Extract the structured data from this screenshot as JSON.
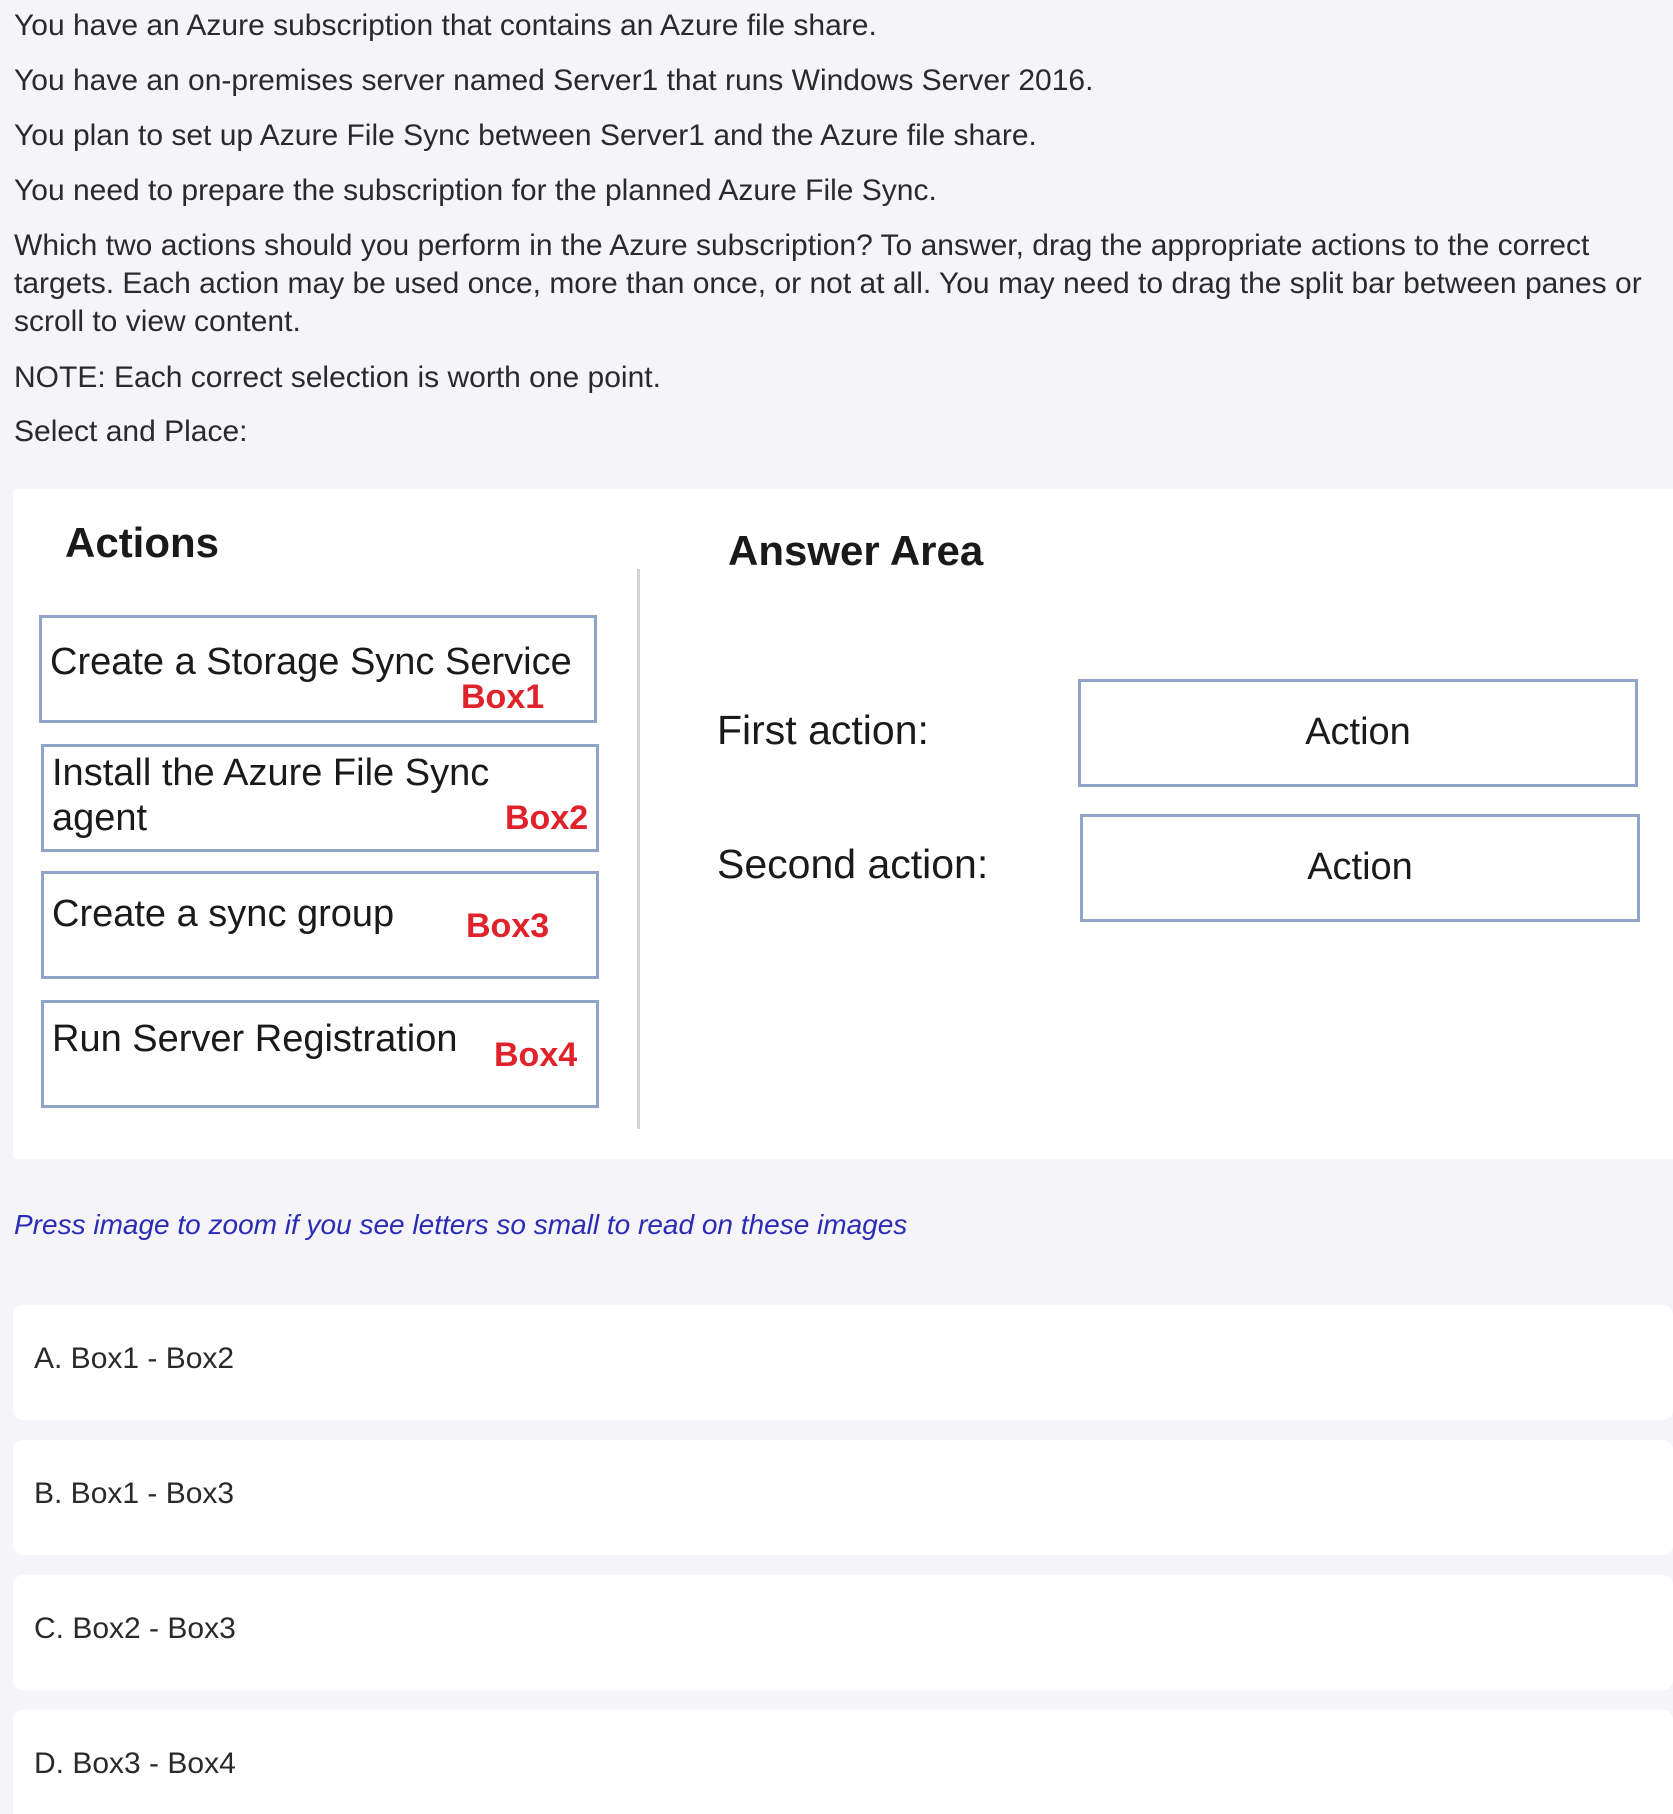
{
  "question": {
    "lines": [
      "You have an Azure subscription that contains an Azure file share.",
      "You have an on-premises server named Server1 that runs Windows Server 2016.",
      "You plan to set up Azure File Sync between Server1 and the Azure file share.",
      "You need to prepare the subscription for the planned Azure File Sync."
    ],
    "instructions": "Which two actions should you perform in the Azure subscription? To answer, drag the appropriate actions to the correct targets. Each action may be used once, more than once, or not at all. You may need to drag the split bar between panes or scroll to view content.",
    "note": "NOTE: Each correct selection is worth one point.",
    "select_label": "Select and Place:"
  },
  "exhibit": {
    "actions_heading": "Actions",
    "answer_heading": "Answer Area",
    "actions": [
      {
        "text": "Create a Storage Sync Service",
        "tag": "Box1"
      },
      {
        "text": "Install the Azure File Sync\nagent",
        "tag": "Box2"
      },
      {
        "text": "Create a sync group",
        "tag": "Box3"
      },
      {
        "text": "Run Server Registration",
        "tag": "Box4"
      }
    ],
    "targets": [
      {
        "label": "First action:",
        "placeholder": "Action"
      },
      {
        "label": "Second action:",
        "placeholder": "Action"
      }
    ]
  },
  "zoom_hint": "Press image to zoom if you see letters so small to read on these images",
  "options": [
    "A. Box1 - Box2",
    "B. Box1 - Box3",
    "C. Box2 - Box3",
    "D. Box3 - Box4"
  ],
  "colors": {
    "page_bg": "#f4f4f9",
    "box_border": "#8fa5c8",
    "tag_red": "#e0222a",
    "hint_blue": "#2b2bb5"
  }
}
